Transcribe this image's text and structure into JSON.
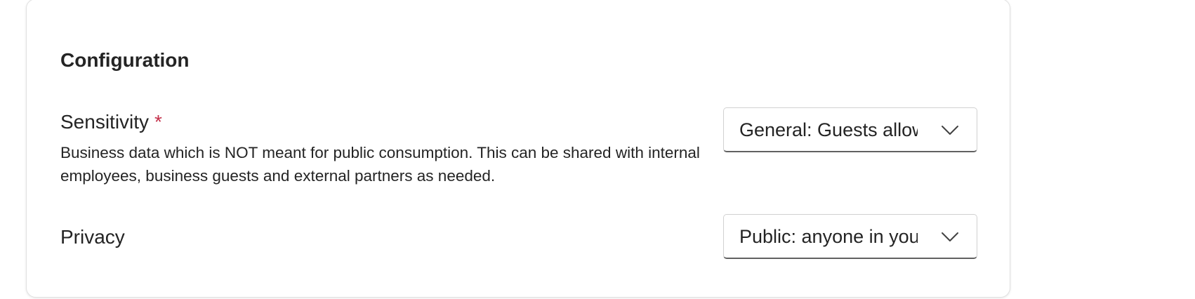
{
  "configuration": {
    "title": "Configuration",
    "sensitivity": {
      "label": "Sensitivity",
      "required_marker": "*",
      "description": "Business data which is NOT meant for public consumption. This can be shared with internal employees, business guests and external partners as needed.",
      "selected_value": "General: Guests allowed"
    },
    "privacy": {
      "label": "Privacy",
      "selected_value": "Public: anyone in your organization"
    }
  },
  "colors": {
    "required": "#c4314b",
    "text": "#242424",
    "border": "#d1d1d1",
    "border_bottom": "#616161"
  },
  "icons": {
    "dropdown_chevron": "chevron-down-icon"
  }
}
